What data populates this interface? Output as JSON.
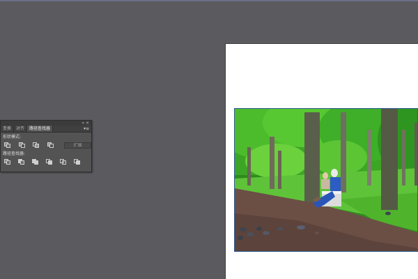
{
  "panel": {
    "tabs": [
      {
        "label": "变换"
      },
      {
        "label": "对齐"
      },
      {
        "label": "路径查找器",
        "active": true
      }
    ],
    "titlebar": {
      "collapse_glyph": "»",
      "close_glyph": "×"
    },
    "menu_glyph": "▾≡",
    "shape_modes": {
      "label": "形状模式:",
      "buttons": [
        "unite-icon",
        "minus-front-icon",
        "intersect-icon",
        "exclude-icon"
      ],
      "expand_label": "扩展"
    },
    "pathfinders": {
      "label": "路径查找器:",
      "buttons": [
        "divide-icon",
        "trim-icon",
        "merge-icon",
        "crop-icon",
        "outline-icon",
        "minus-back-icon"
      ]
    }
  },
  "colors": {
    "workspace": "#5b5a5e",
    "panel_bg": "#535353",
    "artboard": "#ffffff",
    "selection": "#2e5b9a"
  },
  "canvas": {
    "image": "park-bench-photo"
  }
}
